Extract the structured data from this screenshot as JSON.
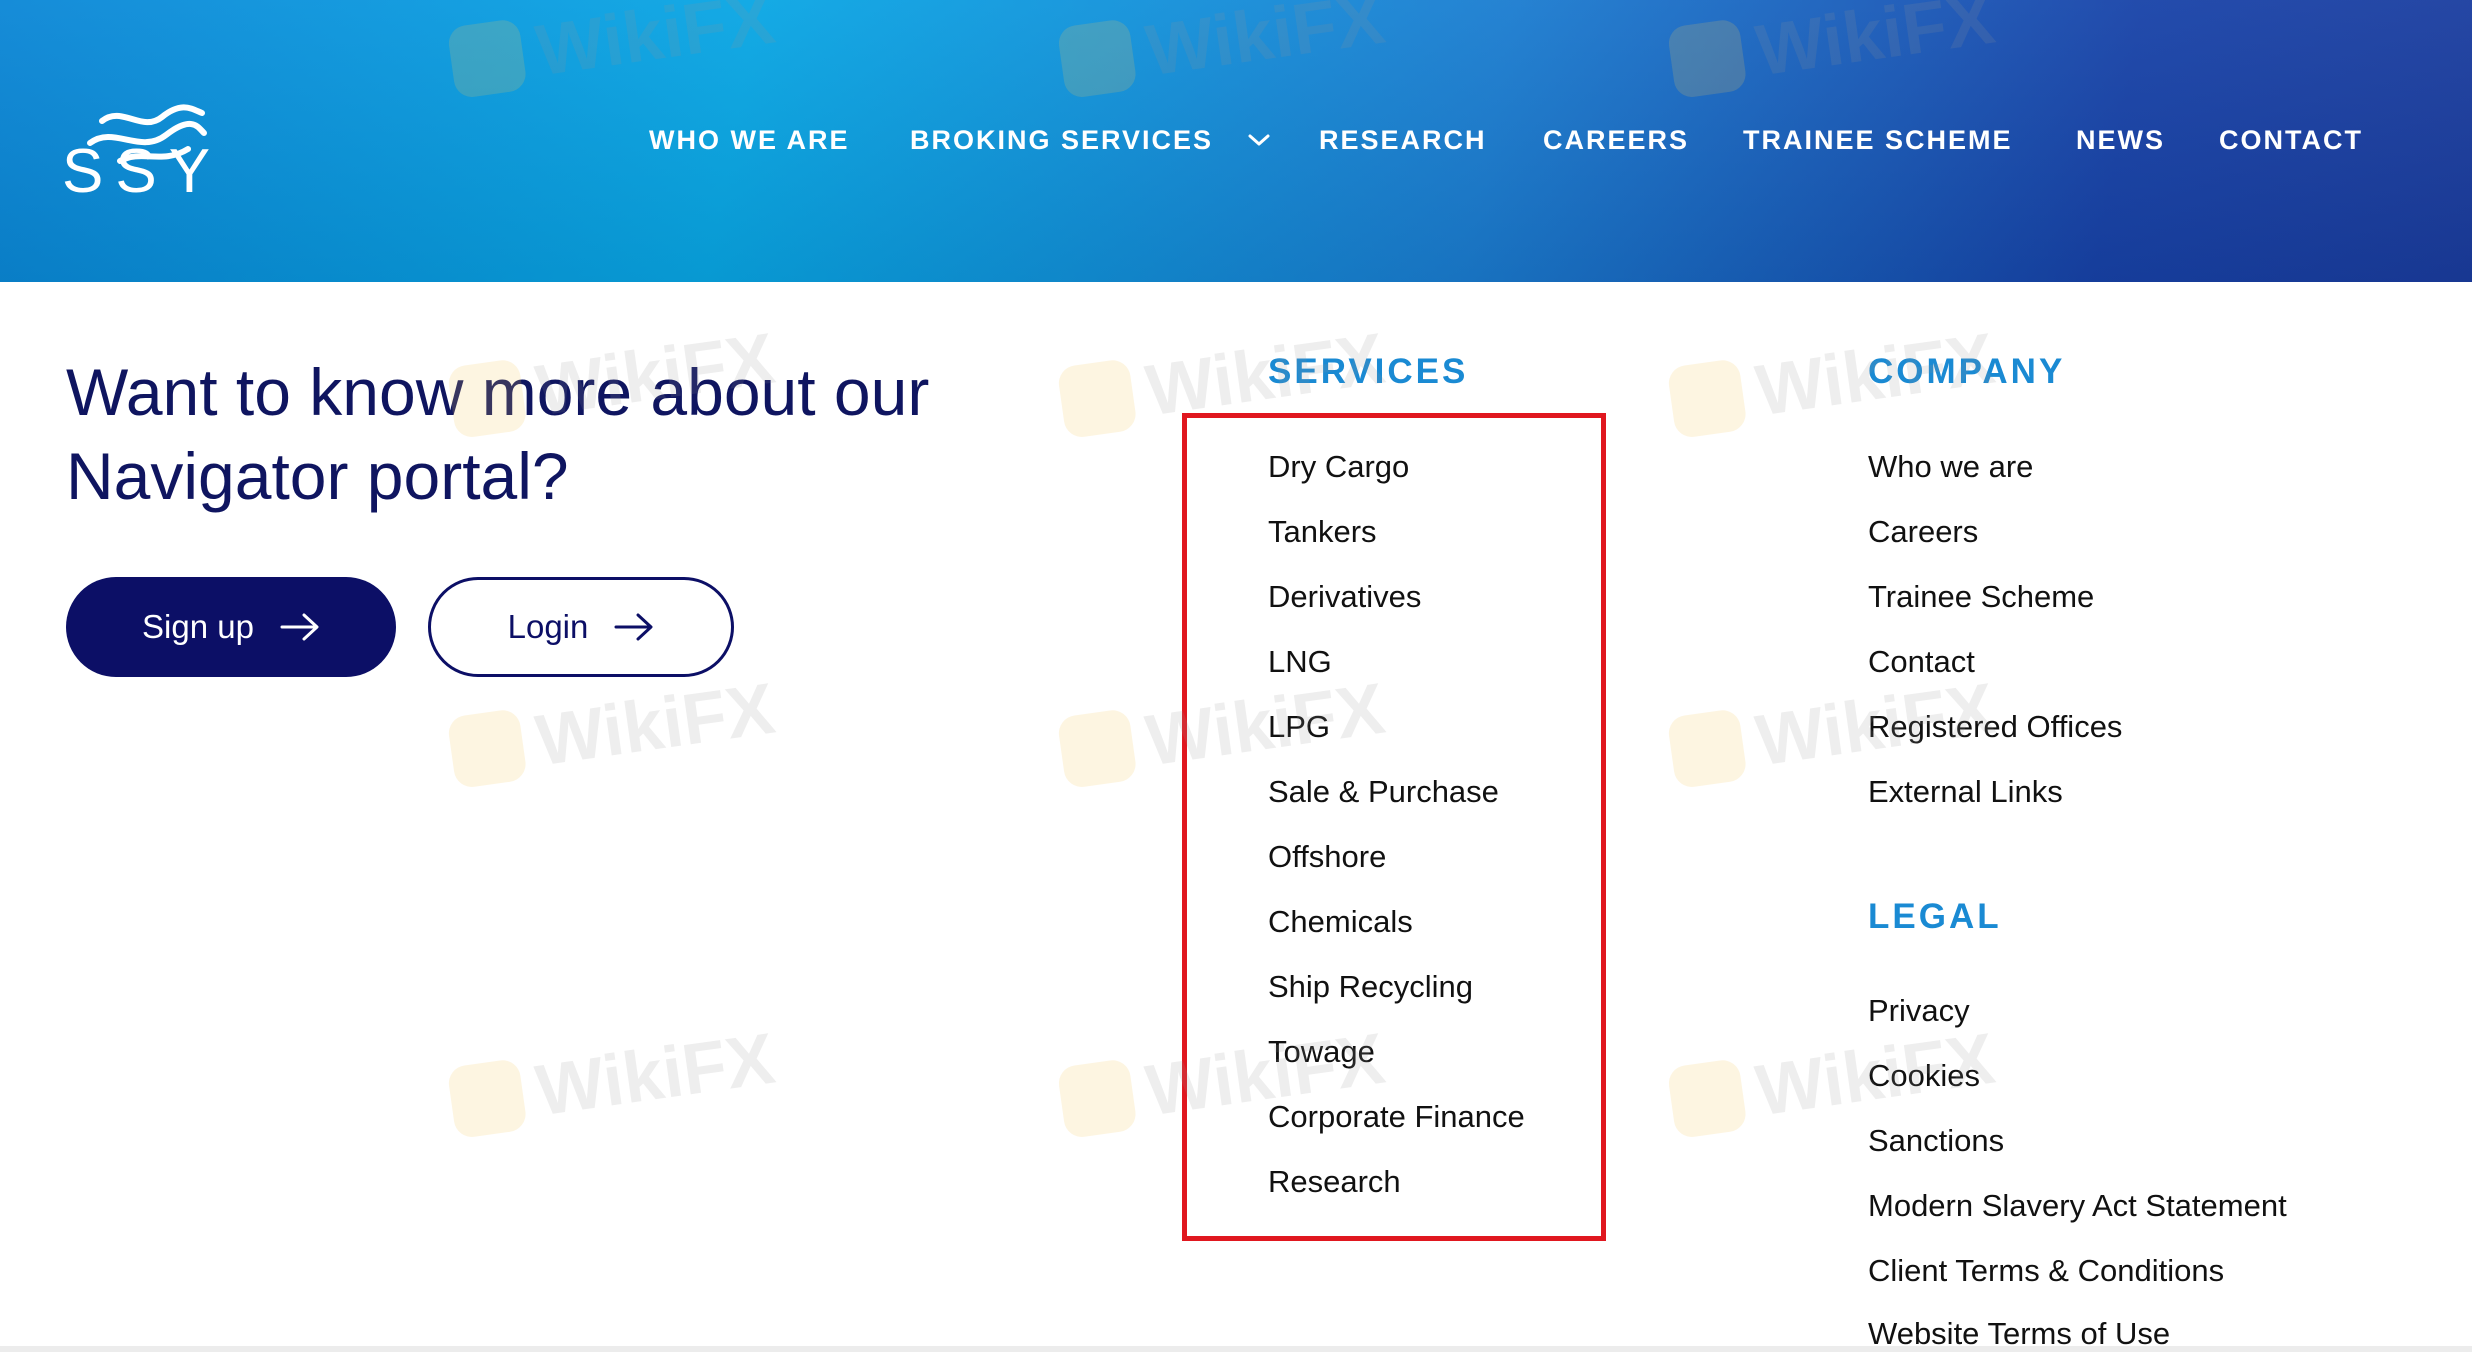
{
  "header": {
    "logo_text": "SSY",
    "nav": [
      {
        "label": "WHO WE ARE"
      },
      {
        "label": "BROKING SERVICES"
      },
      {
        "label": "RESEARCH"
      },
      {
        "label": "CAREERS"
      },
      {
        "label": "TRAINEE SCHEME"
      },
      {
        "label": "NEWS"
      },
      {
        "label": "CONTACT"
      }
    ]
  },
  "cta": {
    "title": "Want to know more about our Navigator portal?",
    "signup_label": "Sign up",
    "login_label": "Login"
  },
  "services": {
    "heading": "SERVICES",
    "items": [
      "Dry Cargo",
      "Tankers",
      "Derivatives",
      "LNG",
      "LPG",
      "Sale & Purchase",
      "Offshore",
      "Chemicals",
      "Ship Recycling",
      "Towage",
      "Corporate Finance",
      "Research"
    ]
  },
  "company": {
    "heading": "COMPANY",
    "items": [
      "Who we are",
      "Careers",
      "Trainee Scheme",
      "Contact",
      "Registered Offices",
      "External Links"
    ]
  },
  "legal": {
    "heading": "LEGAL",
    "items": [
      "Privacy",
      "Cookies",
      "Sanctions",
      "Modern Slavery Act Statement",
      "Client Terms & Conditions",
      "Website Terms of Use"
    ]
  },
  "watermark": {
    "text": "WikiFX"
  },
  "colors": {
    "navy": "#0c0f66",
    "heading_blue": "#1a8ad3",
    "highlight_red": "#e0171f",
    "header_gradient_start": "#08a6e4",
    "header_gradient_end": "#1a3c9e"
  },
  "icons": {
    "logo": "wave-logo-icon",
    "dropdown": "chevron-down-icon",
    "button_arrow": "arrow-right-icon"
  }
}
